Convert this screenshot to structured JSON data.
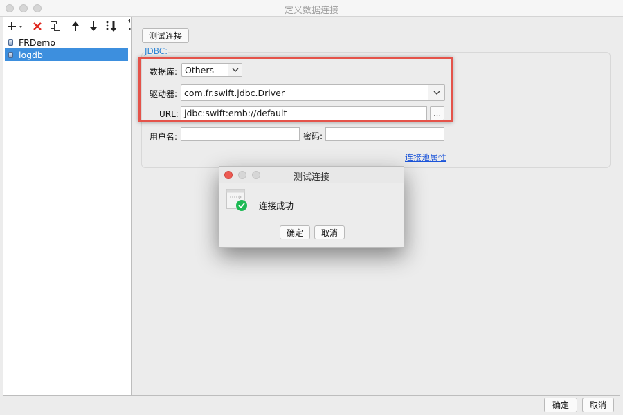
{
  "window": {
    "title": "定义数据连接"
  },
  "left_panel": {
    "toolbar": [
      {
        "name": "add-icon",
        "glyph": "+"
      },
      {
        "name": "delete-icon",
        "glyph": "✕"
      },
      {
        "name": "copy-icon",
        "glyph": "⎘"
      },
      {
        "name": "move-up-icon",
        "glyph": "↑"
      },
      {
        "name": "move-down-icon",
        "glyph": "↓"
      },
      {
        "name": "sort-icon",
        "glyph": "⇊"
      }
    ],
    "connections": [
      {
        "label": "FRDemo",
        "selected": false
      },
      {
        "label": "logdb",
        "selected": true
      }
    ]
  },
  "right_panel": {
    "test_connection_label": "测试连接",
    "group_label": "JDBC:",
    "database_label": "数据库:",
    "database_value": "Others",
    "driver_label": "驱动器:",
    "driver_value": "com.fr.swift.jdbc.Driver",
    "url_label": "URL:",
    "url_value": "jdbc:swift:emb://default",
    "url_browse_label": "...",
    "username_label": "用户名:",
    "username_value": "",
    "password_label": "密码:",
    "password_value": "",
    "pool_properties_label": "连接池属性"
  },
  "dialog": {
    "title": "测试连接",
    "message": "连接成功",
    "ok_label": "确定",
    "cancel_label": "取消"
  },
  "footer": {
    "ok_label": "确定",
    "cancel_label": "取消"
  },
  "colors": {
    "selection": "#3d8fde",
    "highlight": "#e4534a",
    "success": "#1db954",
    "link": "#1b54d9",
    "group_label": "#2f86d6"
  }
}
